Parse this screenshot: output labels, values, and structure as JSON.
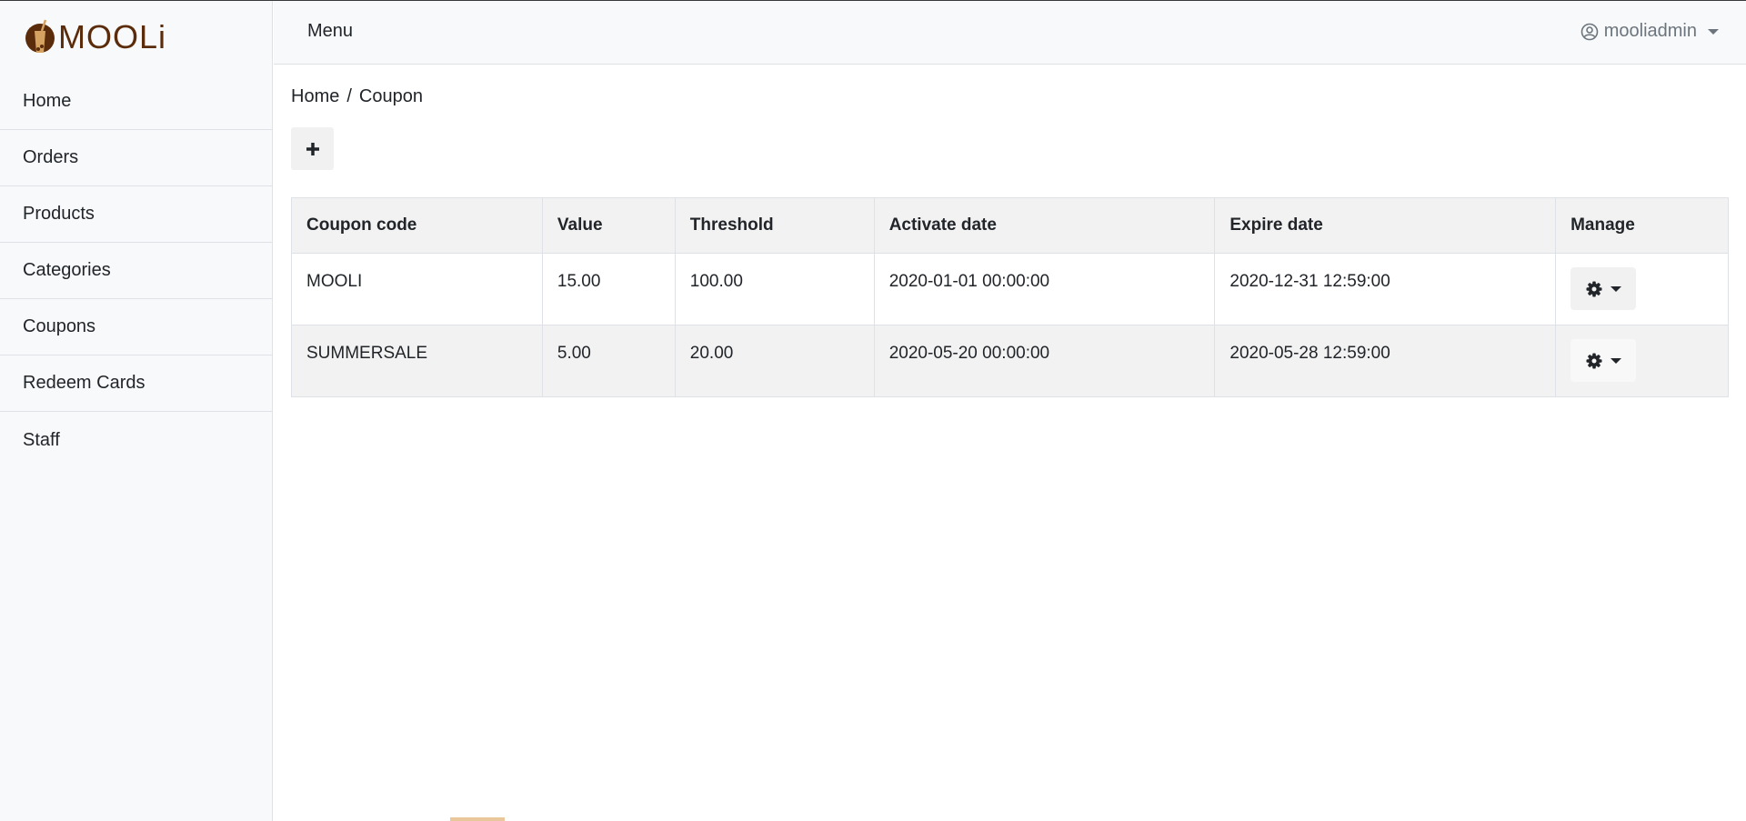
{
  "brand": {
    "name": "MOOLi",
    "colors": {
      "brown": "#5a2c0b",
      "tan": "#c98a3e"
    }
  },
  "sidebar": {
    "items": [
      {
        "label": "Home"
      },
      {
        "label": "Orders"
      },
      {
        "label": "Products"
      },
      {
        "label": "Categories"
      },
      {
        "label": "Coupons"
      },
      {
        "label": "Redeem Cards"
      },
      {
        "label": "Staff"
      }
    ]
  },
  "topbar": {
    "menu_label": "Menu",
    "user_name": "mooliadmin",
    "user_icon": "user-circle-icon"
  },
  "breadcrumb": {
    "home": "Home",
    "separator": "/",
    "current": "Coupon"
  },
  "toolbar": {
    "add_icon": "plus-icon"
  },
  "table": {
    "headers": [
      "Coupon code",
      "Value",
      "Threshold",
      "Activate date",
      "Expire date",
      "Manage"
    ],
    "rows": [
      [
        "MOOLI",
        "15.00",
        "100.00",
        "2020-01-01 00:00:00",
        "2020-12-31 12:59:00"
      ],
      [
        "SUMMERSALE",
        "5.00",
        "20.00",
        "2020-05-20 00:00:00",
        "2020-05-28 12:59:00"
      ]
    ],
    "manage_icon": "gear-icon"
  }
}
